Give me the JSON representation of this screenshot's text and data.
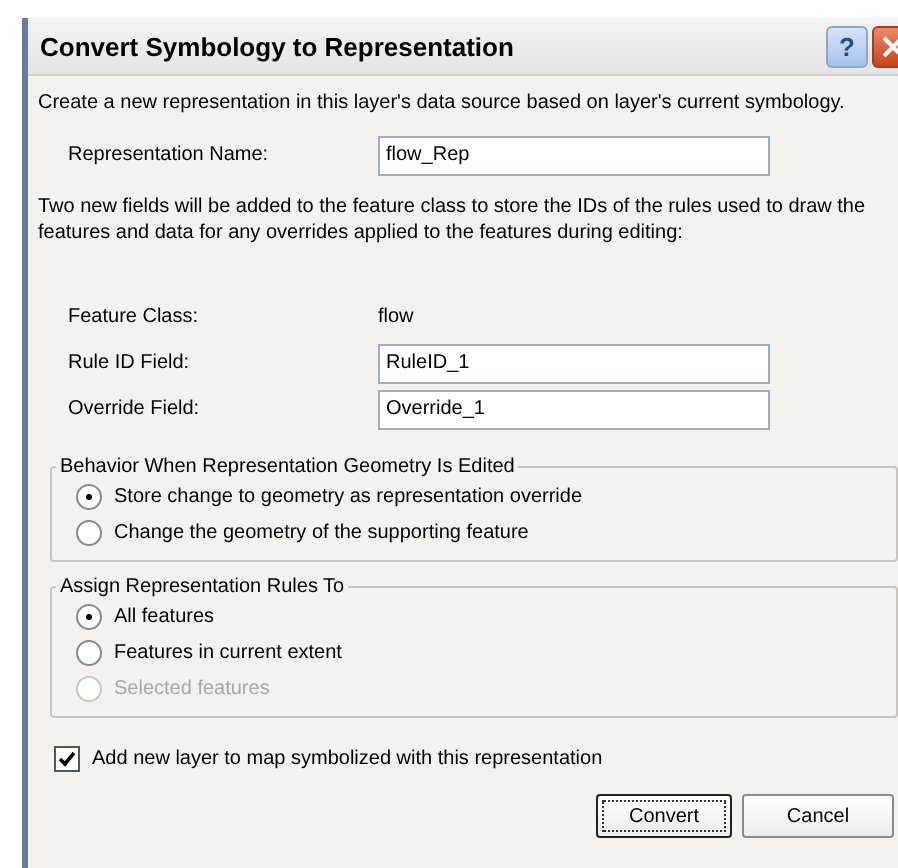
{
  "window": {
    "title": "Convert Symbology to Representation",
    "buttons": [
      {
        "kind": "help",
        "label": "?"
      },
      {
        "kind": "close"
      }
    ]
  },
  "intro": "Create a new representation in this layer's data source based on layer's current symbology.",
  "representation_name": {
    "label": "Representation Name:",
    "value": "flow_Rep"
  },
  "note": "Two new fields will be added to the feature class to store the IDs of the rules used to draw the features and data for any overrides applied to the features during editing:",
  "fields": [
    {
      "kind": "static",
      "label": "Feature Class:",
      "value": "flow"
    },
    {
      "kind": "input",
      "label": "Rule ID Field:",
      "value": "RuleID_1"
    },
    {
      "kind": "input",
      "label": "Override Field:",
      "value": "Override_1"
    }
  ],
  "groups": [
    {
      "title": "Behavior When Representation Geometry Is Edited",
      "options": [
        {
          "label": "Store change to geometry as representation override",
          "selected": true,
          "disabled": false
        },
        {
          "label": "Change the geometry of the supporting feature",
          "selected": false,
          "disabled": false
        }
      ]
    },
    {
      "title": "Assign Representation Rules To",
      "options": [
        {
          "label": "All features",
          "selected": true,
          "disabled": false
        },
        {
          "label": "Features in current extent",
          "selected": false,
          "disabled": false
        },
        {
          "label": "Selected features",
          "selected": false,
          "disabled": true
        }
      ]
    }
  ],
  "add_layer": {
    "label": "Add new layer to map symbolized with this representation",
    "checked": true
  },
  "buttons": [
    {
      "label": "Convert",
      "default": true
    },
    {
      "label": "Cancel",
      "default": false
    }
  ]
}
